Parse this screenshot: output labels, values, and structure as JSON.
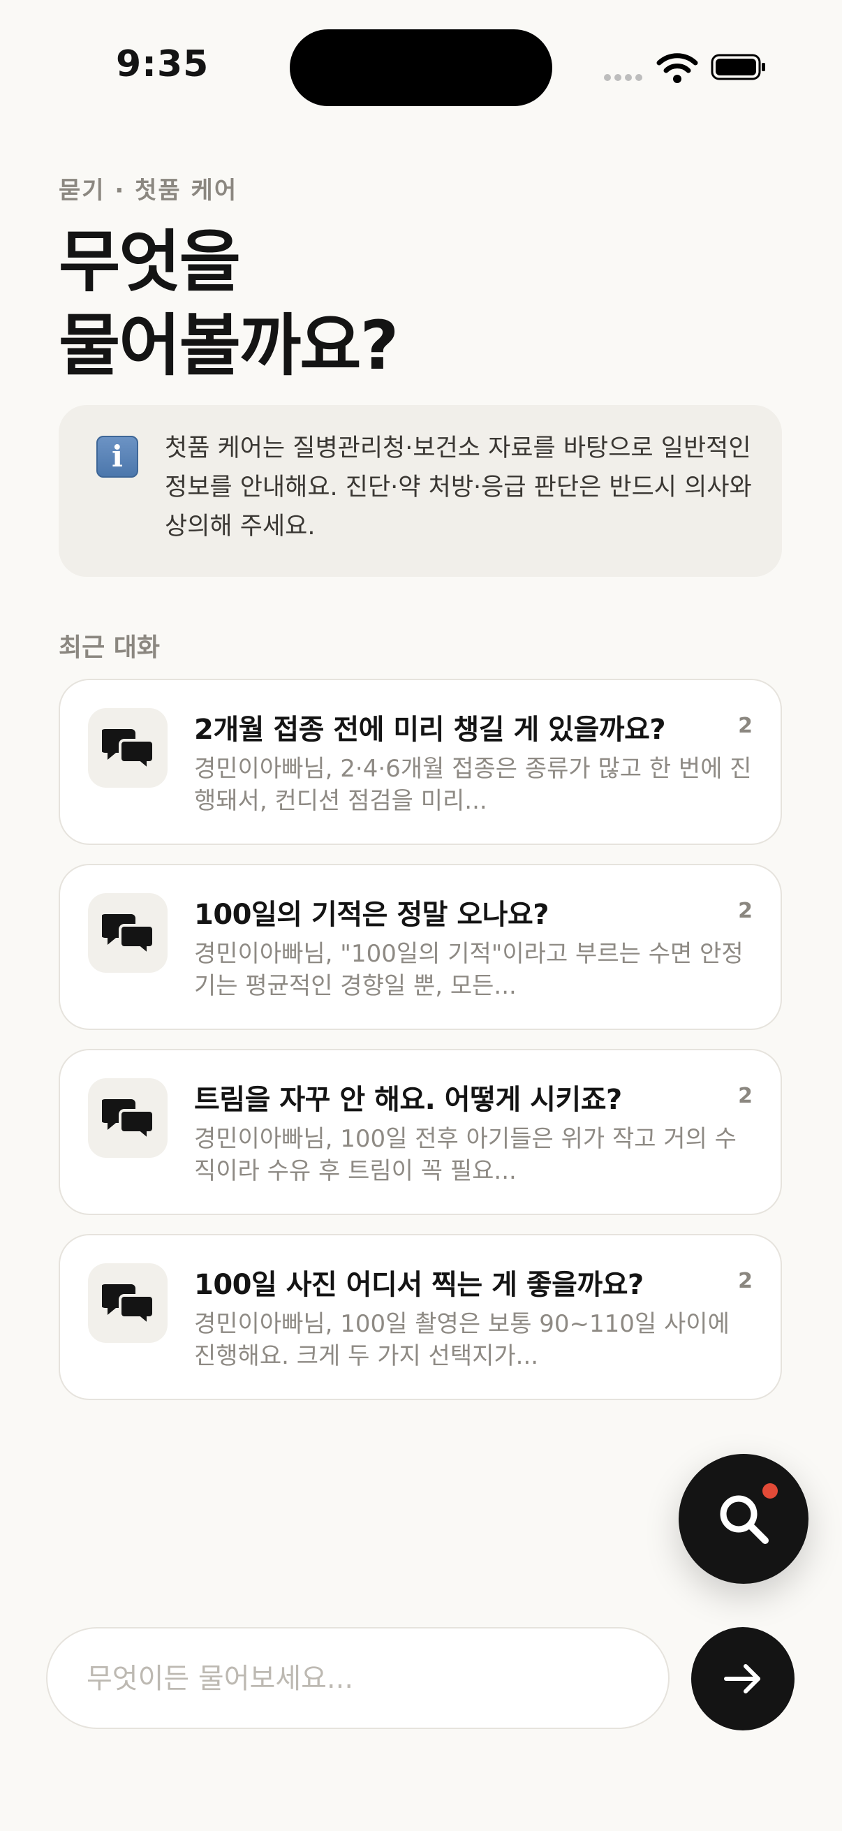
{
  "status_bar": {
    "time": "9:35"
  },
  "header": {
    "eyebrow": "묻기 · 첫품 케어",
    "title_line1": "무엇을",
    "title_line2": "물어볼까요?"
  },
  "notice": {
    "icon": "information-icon",
    "text": "첫품 케어는 질병관리청·보건소 자료를 바탕으로 일반적인 정보를 안내해요. 진단·약 처방·응급 판단은 반드시 의사와 상의해 주세요."
  },
  "recent": {
    "label": "최근 대화",
    "items": [
      {
        "title": "2개월 접종 전에 미리 챙길 게 있을까요?",
        "count": "2",
        "preview": "경민이아빠님, 2·4·6개월 접종은 종류가 많고 한 번에 진행돼서, 컨디션 점검을 미리..."
      },
      {
        "title": "100일의 기적은 정말 오나요?",
        "count": "2",
        "preview": "경민이아빠님, \"100일의 기적\"이라고 부르는 수면 안정기는 평균적인 경향일 뿐, 모든..."
      },
      {
        "title": "트림을 자꾸 안 해요. 어떻게 시키죠?",
        "count": "2",
        "preview": "경민이아빠님, 100일 전후 아기들은 위가 작고 거의 수직이라 수유 후 트림이 꼭 필요..."
      },
      {
        "title": "100일 사진 어디서 찍는 게 좋을까요?",
        "count": "2",
        "preview": "경민이아빠님, 100일 촬영은 보통 90~110일 사이에 진행해요. 크게 두 가지 선택지가..."
      }
    ]
  },
  "composer": {
    "placeholder": "무엇이든 물어보세요...",
    "send_icon": "arrow-right-icon"
  },
  "fab": {
    "icon": "search-icon",
    "badge_color": "#E24A37"
  },
  "colors": {
    "background": "#FAF9F6",
    "dark": "#141414",
    "muted": "#8B8780",
    "accent": "#E24A37"
  }
}
